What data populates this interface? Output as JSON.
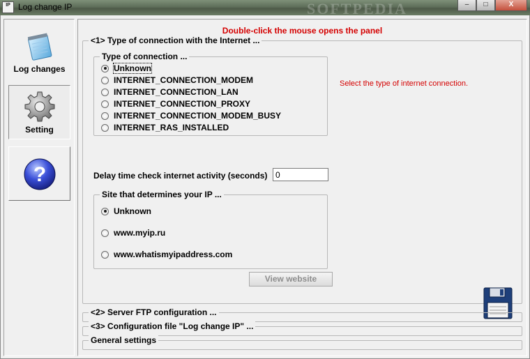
{
  "window": {
    "title": "Log change IP",
    "app_icon_text": "IP",
    "watermark": "SOFTPEDIA",
    "buttons": {
      "minimize": "–",
      "maximize": "□",
      "close": "X"
    }
  },
  "nav": {
    "items": [
      {
        "label": "Log changes",
        "icon": "notepad-icon"
      },
      {
        "label": "Setting",
        "icon": "gear-icon"
      },
      {
        "label": "",
        "icon": "help-icon"
      }
    ]
  },
  "content": {
    "header": "Double-click the mouse opens the panel",
    "section1": {
      "legend": "<1>  Type of connection with the Internet  ...",
      "connection_group": {
        "legend": "Type of connection  ...",
        "options": [
          "Unknown",
          "INTERNET_CONNECTION_MODEM",
          "INTERNET_CONNECTION_LAN",
          "INTERNET_CONNECTION_PROXY",
          "INTERNET_CONNECTION_MODEM_BUSY",
          "INTERNET_RAS_INSTALLED"
        ],
        "selected": 0
      },
      "hint": "Select the type of internet connection.",
      "delay_label": "Delay time check internet activity (seconds)",
      "delay_value": "0",
      "site_group": {
        "legend": "Site that determines your IP  ...",
        "options": [
          "Unknown",
          "www.myip.ru",
          "www.whatismyipaddress.com"
        ],
        "selected": 0
      },
      "view_button": "View website"
    },
    "section2": {
      "legend": "<2>  Server FTP configuration  ..."
    },
    "section3": {
      "legend": "<3>  Configuration file \"Log change IP\"  ..."
    },
    "section4": {
      "legend": "General settings"
    }
  }
}
